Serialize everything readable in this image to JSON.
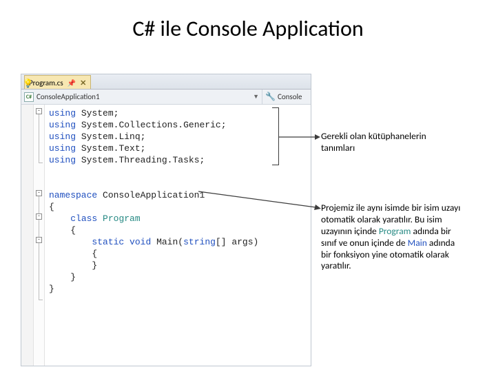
{
  "title": "C# ile Console Application",
  "ide": {
    "tab": {
      "name": "Program.cs",
      "pin_icon": "📌",
      "close_icon": "✕"
    },
    "nav": {
      "project": "ConsoleApplication1",
      "member": "Console"
    },
    "code": {
      "l1_kw": "using",
      "l1_ns": "System",
      "l2_kw": "using",
      "l2_ns1": "System",
      "l2_ns2": "Collections",
      "l2_ns3": "Generic",
      "l3_kw": "using",
      "l3_ns1": "System",
      "l3_ns2": "Linq",
      "l4_kw": "using",
      "l4_ns1": "System",
      "l4_ns2": "Text",
      "l5_kw": "using",
      "l5_ns1": "System",
      "l5_ns2": "Threading",
      "l5_ns3": "Tasks",
      "ns_kw": "namespace",
      "ns_name": "ConsoleApplication1",
      "cls_kw": "class",
      "cls_name": "Program",
      "m_kw1": "static",
      "m_kw2": "void",
      "m_name": "Main",
      "m_argtype": "string",
      "m_argname": "args"
    }
  },
  "callouts": {
    "libs": "Gerekli olan kütüphanelerin tanımları",
    "ns_a": "Projemiz ile aynı isimde bir isim uzayı otomatik olarak yaratılır. Bu isim uzayının içinde ",
    "ns_program": "Program",
    "ns_b": " adında bir sınıf ve onun içinde de ",
    "ns_main": "Main",
    "ns_c": " adında bir fonksiyon yine otomatik olarak yaratılır."
  }
}
